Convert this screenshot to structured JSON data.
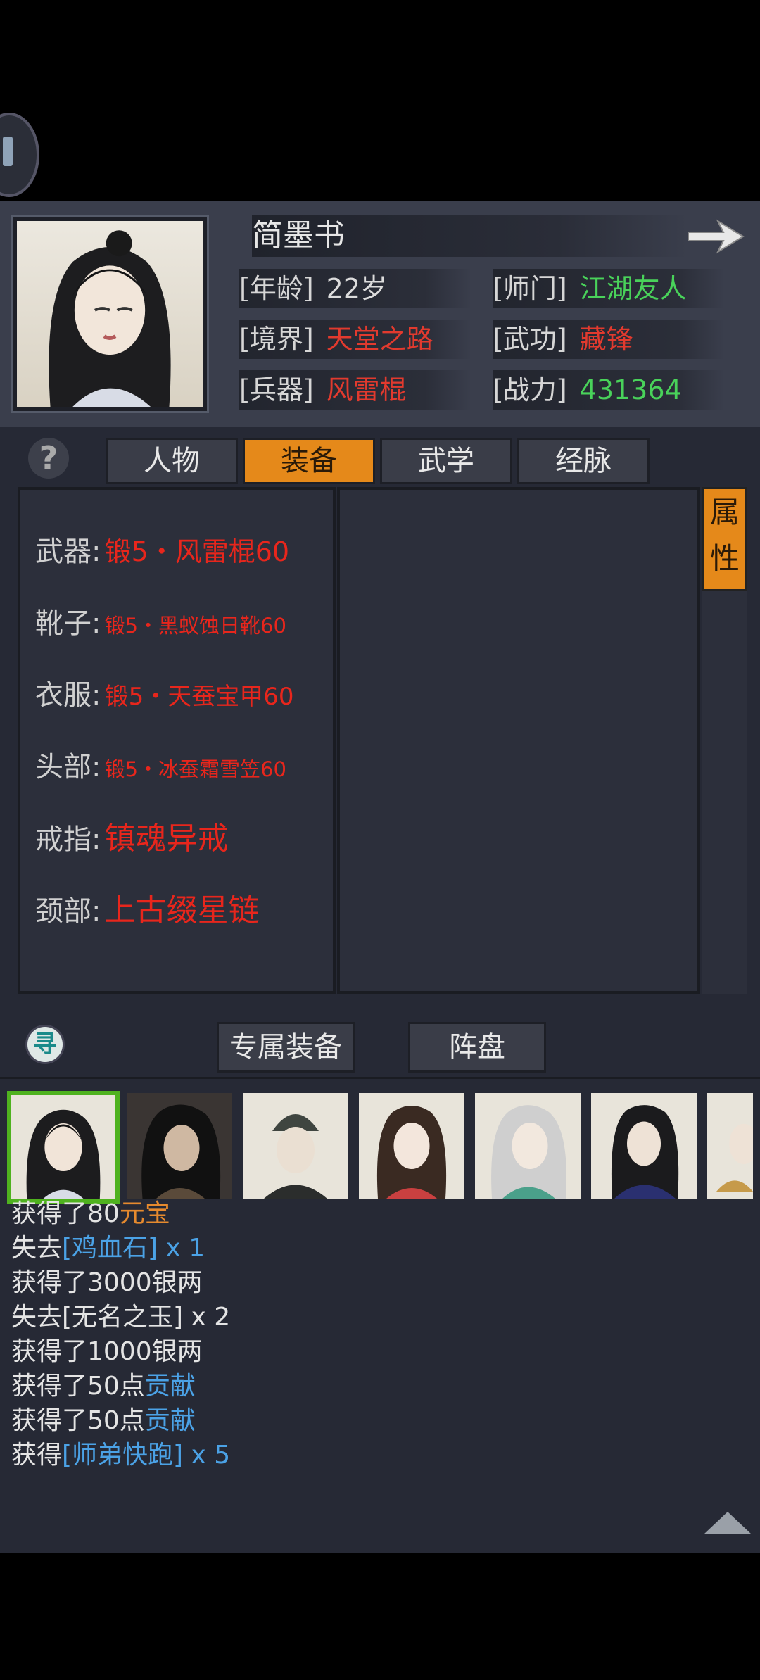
{
  "character": {
    "name": "简墨书",
    "age_label": "[年龄]",
    "age_value": "22岁",
    "sect_label": "[师门]",
    "sect_value": "江湖友人",
    "realm_label": "[境界]",
    "realm_value": "天堂之路",
    "skill_label": "[武功]",
    "skill_value": "藏锋",
    "weapon_label": "[兵器]",
    "weapon_value": "风雷棍",
    "power_label": "[战力]",
    "power_value": "431364"
  },
  "tabs": [
    {
      "label": "人物",
      "active": false
    },
    {
      "label": "装备",
      "active": true
    },
    {
      "label": "武学",
      "active": false
    },
    {
      "label": "经脉",
      "active": false
    }
  ],
  "help_glyph": "?",
  "side_tab": {
    "line1": "属",
    "line2": "性"
  },
  "equipment": [
    {
      "slot": "武器:",
      "item": "锻5・风雷棍60"
    },
    {
      "slot": "靴子:",
      "item": "锻5・黑蚁蚀日靴60"
    },
    {
      "slot": "衣服:",
      "item": "锻5・天蚕宝甲60"
    },
    {
      "slot": "头部:",
      "item": "锻5・冰蚕霜雪笠60"
    },
    {
      "slot": "戒指:",
      "item": "镇魂异戒"
    },
    {
      "slot": "颈部:",
      "item": "上古缀星链"
    }
  ],
  "bottom_buttons": {
    "exclusive": "专属装备",
    "formation": "阵盘",
    "search_glyph": "寻"
  },
  "log": [
    [
      {
        "t": "获得了80",
        "c": "white"
      },
      {
        "t": "元宝",
        "c": "orange"
      }
    ],
    [
      {
        "t": "失去",
        "c": "white"
      },
      {
        "t": "[鸡血石] x 1",
        "c": "blue"
      }
    ],
    [
      {
        "t": "获得了3000银两",
        "c": "white"
      }
    ],
    [
      {
        "t": "失去[无名之玉] x 2",
        "c": "white"
      }
    ],
    [
      {
        "t": "获得了1000银两",
        "c": "white"
      }
    ],
    [
      {
        "t": "获得了50点",
        "c": "white"
      },
      {
        "t": "贡献",
        "c": "blue"
      }
    ],
    [
      {
        "t": "获得了50点",
        "c": "white"
      },
      {
        "t": "贡献",
        "c": "blue"
      }
    ],
    [
      {
        "t": "获得",
        "c": "white"
      },
      {
        "t": "[师弟快跑] x 5",
        "c": "blue"
      }
    ]
  ],
  "colors": {
    "accent": "#e5891a",
    "red": "#e23a2e",
    "green": "#49d25a",
    "blue": "#4ba2e6",
    "selected": "#4fb21f"
  }
}
